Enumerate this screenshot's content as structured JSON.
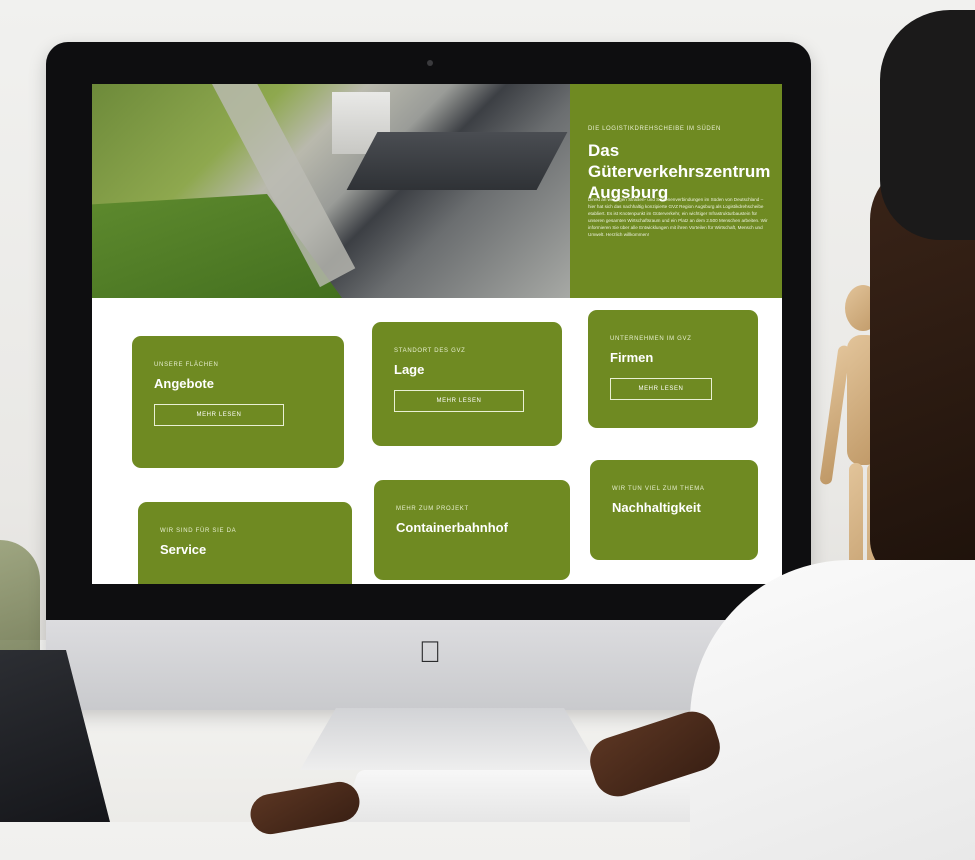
{
  "hero": {
    "eyebrow": "DIE LOGISTIKDREHSCHEIBE IM SÜDEN",
    "title": "Das Güterverkehrszentrum Augsburg",
    "text": "Direkt an wichtigen Straßen- und Schienenverbindungen im Süden von Deutschland – hier hat sich das nachhaltig konzipierte GVZ Region Augsburg als Logistikdrehscheibe etabliert. Es ist Knotenpunkt im Güterverkehr, ein wichtiger Infrastrukturbaustein für unseren gesamten Wirtschaftsraum und ein Platz an dem 2.500 Menschen arbeiten. Wir informieren Sie über alle Entwicklungen mit ihren Vorteilen für Wirtschaft, Mensch und Umwelt. Herzlich willkommen!"
  },
  "cards": [
    {
      "eyebrow": "UNSERE FLÄCHEN",
      "title": "Angebote",
      "button": "MEHR LESEN"
    },
    {
      "eyebrow": "STANDORT DES GVZ",
      "title": "Lage",
      "button": "MEHR LESEN"
    },
    {
      "eyebrow": "UNTERNEHMEN IM GVZ",
      "title": "Firmen",
      "button": "MEHR LESEN"
    },
    {
      "eyebrow": "WIR SIND FÜR SIE DA",
      "title": "Service"
    },
    {
      "eyebrow": "MEHR ZUM PROJEKT",
      "title": "Containerbahnhof"
    },
    {
      "eyebrow": "WIR TUN VIEL ZUM THEMA",
      "title": "Nachhaltigkeit"
    }
  ],
  "colors": {
    "brand_green": "#6f8a22"
  },
  "icons": {
    "apple_logo": "apple-logo-icon"
  }
}
